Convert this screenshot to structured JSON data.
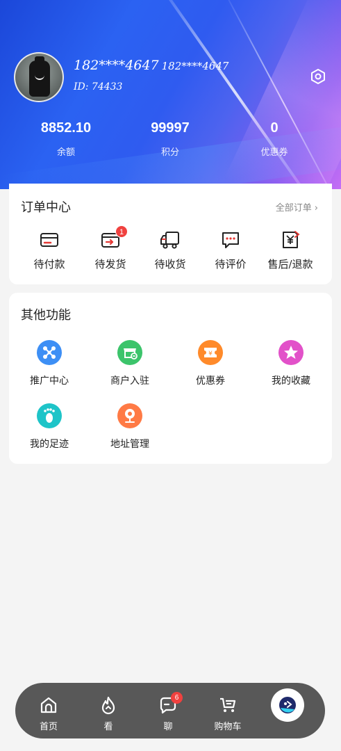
{
  "profile": {
    "nickname": "182****4647",
    "phone": "182****4647",
    "user_id": "ID: 74433"
  },
  "stats": [
    {
      "value": "8852.10",
      "label": "余额"
    },
    {
      "value": "99997",
      "label": "积分"
    },
    {
      "value": "0",
      "label": "优惠券"
    }
  ],
  "orders": {
    "title": "订单中心",
    "all_link": "全部订单",
    "items": [
      {
        "label": "待付款",
        "icon": "wallet-icon",
        "badge": null
      },
      {
        "label": "待发货",
        "icon": "shipping-box-icon",
        "badge": "1"
      },
      {
        "label": "待收货",
        "icon": "truck-icon",
        "badge": null
      },
      {
        "label": "待评价",
        "icon": "comment-icon",
        "badge": null
      },
      {
        "label": "售后/退款",
        "icon": "refund-icon",
        "badge": null
      }
    ]
  },
  "others": {
    "title": "其他功能",
    "items": [
      {
        "label": "推广中心",
        "icon": "share-network-icon",
        "color": "#3d8ff5"
      },
      {
        "label": "商户入驻",
        "icon": "storefront-icon",
        "color": "#3cc46b"
      },
      {
        "label": "优惠券",
        "icon": "coupon-icon",
        "color": "#ff8a2a"
      },
      {
        "label": "我的收藏",
        "icon": "star-icon",
        "color": "#e251c9"
      },
      {
        "label": "我的足迹",
        "icon": "footprint-icon",
        "color": "#1ec4c8"
      },
      {
        "label": "地址管理",
        "icon": "location-pin-icon",
        "color": "#ff7a45"
      }
    ]
  },
  "tabbar": {
    "items": [
      {
        "label": "首页",
        "icon": "home-icon"
      },
      {
        "label": "看",
        "icon": "flame-icon"
      },
      {
        "label": "聊",
        "icon": "chat-icon",
        "badge": "6"
      },
      {
        "label": "购物车",
        "icon": "cart-icon"
      }
    ],
    "service_icon": "customer-service-icon"
  },
  "colors": {
    "badge": "#f0413f",
    "icon_red": "#e53935",
    "tabbar_bg": "#585858"
  }
}
